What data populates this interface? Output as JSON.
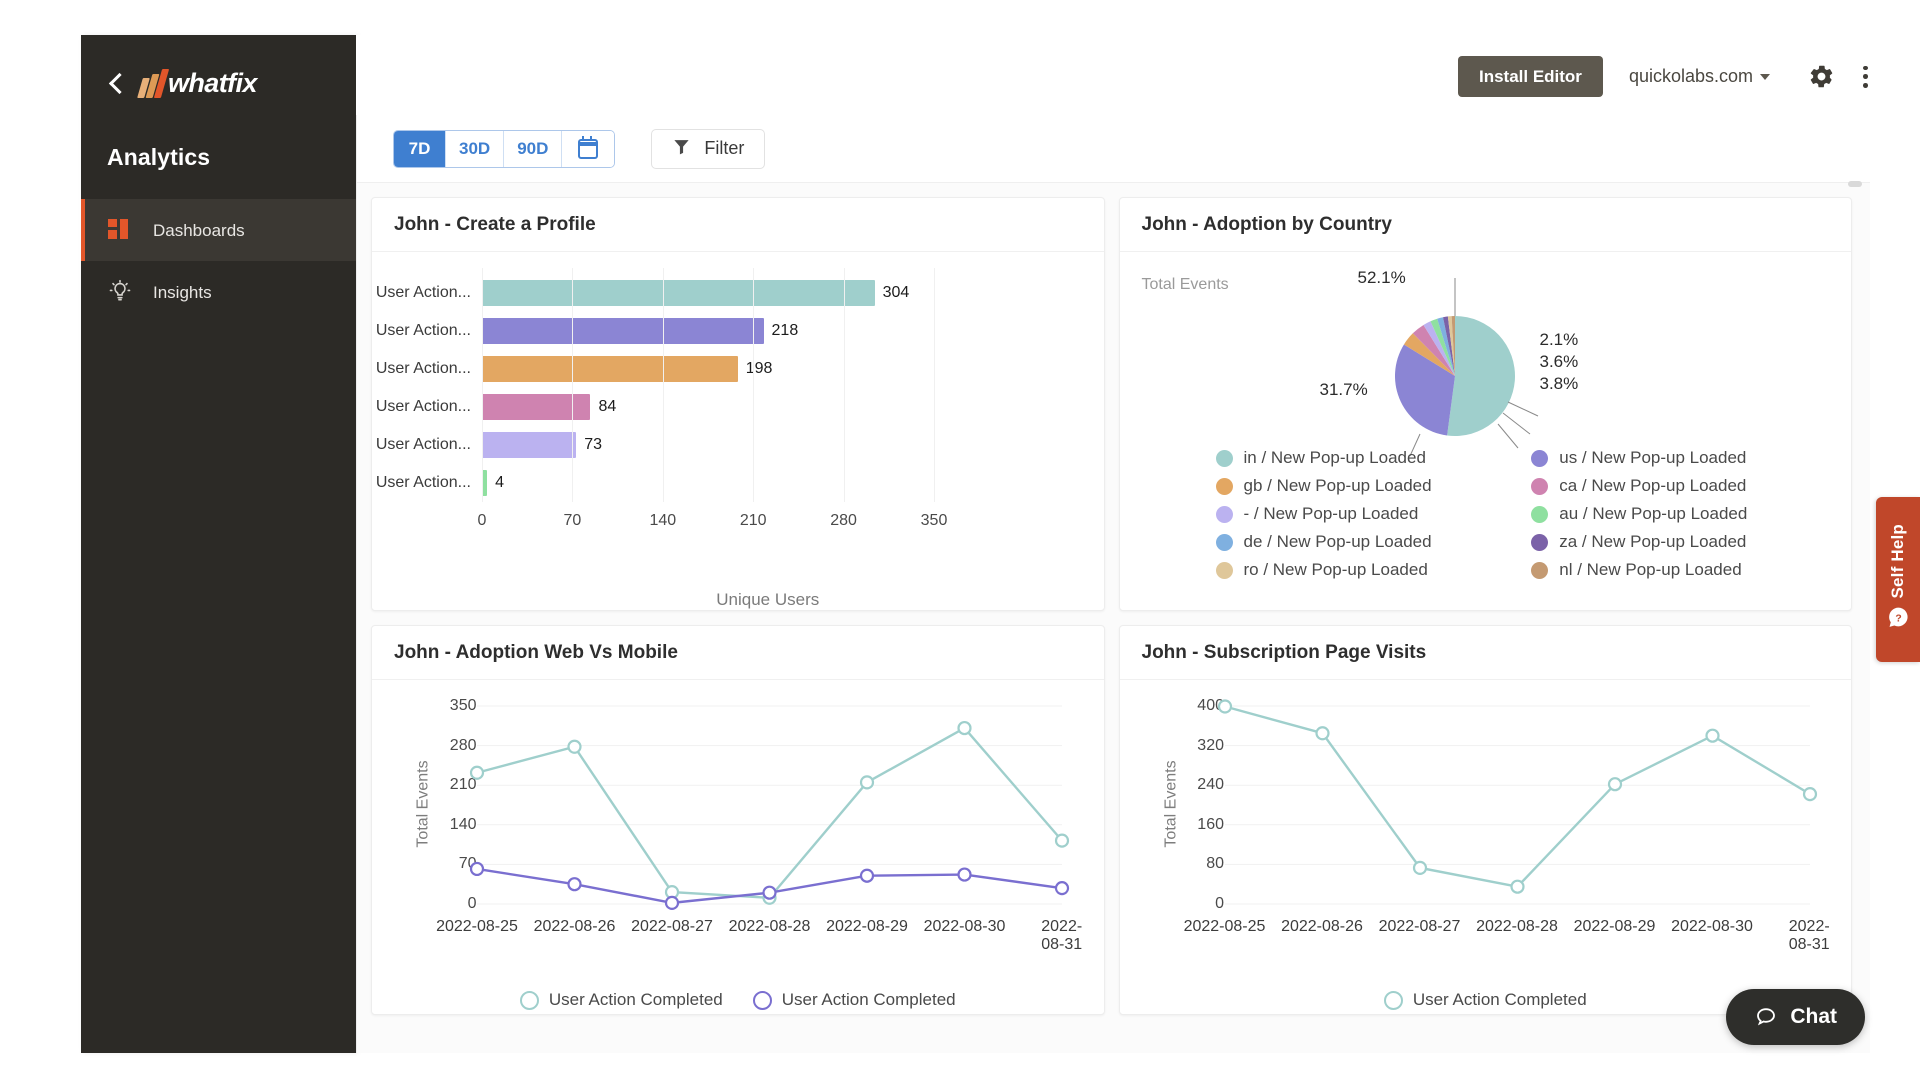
{
  "sidebar": {
    "back_icon": "chevron-left-icon",
    "logo_text": "whatfix",
    "title": "Analytics",
    "items": [
      {
        "label": "Dashboards",
        "icon": "dashboards-icon",
        "active": true
      },
      {
        "label": "Insights",
        "icon": "lightbulb-icon",
        "active": false
      }
    ]
  },
  "header": {
    "install_label": "Install Editor",
    "domain": "quickolabs.com",
    "gear_icon": "gear-icon",
    "more_icon": "kebab-menu-icon"
  },
  "toolbar": {
    "ranges": [
      {
        "label": "7D",
        "selected": true
      },
      {
        "label": "30D",
        "selected": false
      },
      {
        "label": "90D",
        "selected": false
      }
    ],
    "calendar_icon": "calendar-icon",
    "filter_label": "Filter",
    "filter_icon": "funnel-icon"
  },
  "widgets": {
    "bar": {
      "title": "John - Create a Profile"
    },
    "pie": {
      "title": "John - Adoption by Country",
      "metric_label": "Total Events"
    },
    "line_web_mobile": {
      "title": "John - Adoption Web Vs Mobile"
    },
    "line_subscription": {
      "title": "John - Subscription Page Visits"
    }
  },
  "rail": {
    "self_help_label": "Self Help",
    "help_icon": "question-chat-icon"
  },
  "chat": {
    "label": "Chat",
    "icon": "chat-bubble-icon"
  },
  "colors": {
    "brand_orange": "#e2562a",
    "sidebar_bg": "#2c2a26",
    "accent_blue": "#3f7fd0",
    "teal": "#9fcfcc",
    "purple": "#8b85d4",
    "orange": "#e3a762",
    "pink": "#cf83b0",
    "lavender": "#bbb2f0",
    "green": "#8fe0a0"
  },
  "chart_data": [
    {
      "type": "bar",
      "orientation": "horizontal",
      "title": "John - Create a Profile",
      "categories": [
        "User Action...",
        "User Action...",
        "User Action...",
        "User Action...",
        "User Action...",
        "User Action..."
      ],
      "values": [
        304,
        218,
        198,
        84,
        73,
        4
      ],
      "colors": [
        "#9fcfcc",
        "#8b85d4",
        "#e3a762",
        "#cf83b0",
        "#bbb2f0",
        "#8fe0a0"
      ],
      "xlabel": "Unique Users",
      "ylabel": "",
      "xlim": [
        0,
        350
      ],
      "xticks": [
        0,
        70,
        140,
        210,
        280,
        350
      ],
      "grid": true,
      "data_labels": true,
      "legend": "none"
    },
    {
      "type": "pie",
      "title": "John - Adoption by Country",
      "metric_label": "Total Events",
      "labels": [
        "in / New Pop-up Loaded",
        "us / New Pop-up Loaded",
        "gb / New Pop-up Loaded",
        "ca / New Pop-up Loaded",
        "- / New Pop-up Loaded",
        "au / New Pop-up Loaded",
        "de / New Pop-up Loaded",
        "za / New Pop-up Loaded",
        "ro / New Pop-up Loaded",
        "nl / New Pop-up Loaded"
      ],
      "values": [
        52.1,
        31.7,
        3.8,
        3.6,
        2.1,
        1.9,
        1.6,
        1.3,
        1.0,
        0.9
      ],
      "colors": [
        "#9fcfcc",
        "#8b85d4",
        "#e3a762",
        "#cf83b0",
        "#bbb2f0",
        "#8fe0a0",
        "#7fb0e0",
        "#7b62a8",
        "#dfc79a",
        "#c49a72"
      ],
      "annotations": [
        "52.1%",
        "31.7%",
        "3.8%",
        "3.6%",
        "2.1%"
      ],
      "legend": "bottom"
    },
    {
      "type": "line",
      "title": "John - Adoption Web Vs Mobile",
      "x": [
        "2022-08-25",
        "2022-08-26",
        "2022-08-27",
        "2022-08-28",
        "2022-08-29",
        "2022-08-30",
        "2022-08-31"
      ],
      "series": [
        {
          "name": "User Action Completed",
          "color": "#9fcfcc",
          "values": [
            232,
            278,
            21,
            11,
            215,
            311,
            112
          ]
        },
        {
          "name": "User Action Completed",
          "color": "#7a6fd0",
          "values": [
            62,
            35,
            2,
            20,
            50,
            52,
            28
          ]
        }
      ],
      "ylabel": "Total Events",
      "xlabel": "",
      "ylim": [
        0,
        350
      ],
      "yticks": [
        0,
        70,
        140,
        210,
        280,
        350
      ],
      "grid": true,
      "legend": "bottom"
    },
    {
      "type": "line",
      "title": "John - Subscription Page Visits",
      "x": [
        "2022-08-25",
        "2022-08-26",
        "2022-08-27",
        "2022-08-28",
        "2022-08-29",
        "2022-08-30",
        "2022-08-31"
      ],
      "series": [
        {
          "name": "User Action Completed",
          "color": "#9fcfcc",
          "values": [
            399,
            345,
            73,
            35,
            242,
            340,
            222
          ]
        }
      ],
      "ylabel": "Total Events",
      "xlabel": "",
      "ylim": [
        0,
        400
      ],
      "yticks": [
        0,
        80,
        160,
        240,
        320,
        400
      ],
      "grid": true,
      "legend": "bottom"
    }
  ]
}
